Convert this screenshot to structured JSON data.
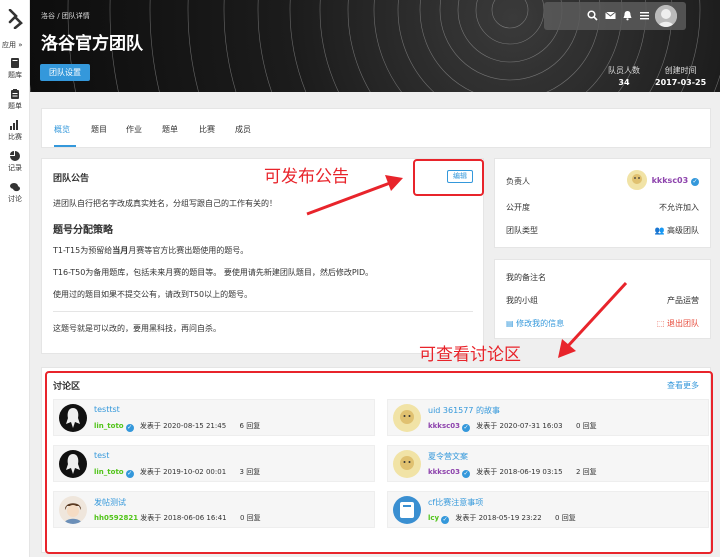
{
  "sidebar": {
    "apps_label": "应用 »",
    "items": [
      {
        "label": "题库",
        "icon": "book-icon"
      },
      {
        "label": "题单",
        "icon": "list-icon"
      },
      {
        "label": "比赛",
        "icon": "chart-bar-icon"
      },
      {
        "label": "记录",
        "icon": "pie-chart-icon"
      },
      {
        "label": "讨论",
        "icon": "comments-icon"
      }
    ]
  },
  "banner": {
    "breadcrumb": "洛谷 / 团队详情",
    "title": "洛谷官方团队",
    "settings_label": "团队设置",
    "member_count_label": "队员人数",
    "member_count": "34",
    "created_label": "创建时间",
    "created_date": "2017-03-25"
  },
  "topbar": {
    "icons": [
      "search-icon",
      "mail-icon",
      "bell-icon",
      "menu-icon"
    ]
  },
  "tabs": [
    "概览",
    "题目",
    "作业",
    "题单",
    "比赛",
    "成员"
  ],
  "announcement": {
    "title": "团队公告",
    "edit_label": "编辑",
    "line1": "进团队自行把名字改成真实姓名，分组写跟自己的工作有关的！",
    "subtitle": "题号分配策略",
    "line2a": "T1-T15为预留给",
    "line2b": "当月",
    "line2c": "月赛等官方比赛出题使用的题号。",
    "line3": "T16-T50为备用题库，包括未来月赛的题目等。 要使用请先新建团队题目，然后修改PID。",
    "line4": "使用过的题目如果不提交公有，请改到T50以上的题号。",
    "line5": "这题号就是可以改的，要用黑科技，再问自杀。"
  },
  "info": {
    "owner_label": "负责人",
    "owner_name": "kkksc03",
    "visibility_label": "公开度",
    "visibility_value": "不允许加入",
    "type_label": "团队类型",
    "type_value": "高级团队"
  },
  "my": {
    "note_label": "我的备注名",
    "group_label": "我的小组",
    "group_value": "产品运营",
    "edit_info_label": "修改我的信息",
    "leave_label": "退出团队"
  },
  "discussion": {
    "title": "讨论区",
    "more_label": "查看更多",
    "posted_prefix": "发表于",
    "posts": [
      {
        "title": "testtst",
        "user": "lin_toto",
        "date": "2020-08-15 21:45",
        "replies": "6 回复"
      },
      {
        "title": "uid 361577 的故事",
        "user": "kkksc03",
        "date": "2020-07-31 16:03",
        "replies": "0 回复"
      },
      {
        "title": "test",
        "user": "lin_toto",
        "date": "2019-10-02 00:01",
        "replies": "3 回复"
      },
      {
        "title": "夏令营文案",
        "user": "kkksc03",
        "date": "2018-06-19 03:15",
        "replies": "2 回复"
      },
      {
        "title": "发帖测试",
        "user": "hh0592821",
        "date": "2018-06-06 16:41",
        "replies": "0 回复"
      },
      {
        "title": "cf比赛注意事项",
        "user": "lcy",
        "date": "2018-05-19 23:22",
        "replies": "0 回复"
      }
    ]
  },
  "annotations": {
    "publish_note": "可发布公告",
    "discussion_note": "可查看讨论区"
  },
  "colors": {
    "accent": "#3498db",
    "annotation_red": "#e8242b",
    "username_purple": "#8e44ad",
    "username_green": "#52c41a",
    "danger": "#e74c3c"
  }
}
